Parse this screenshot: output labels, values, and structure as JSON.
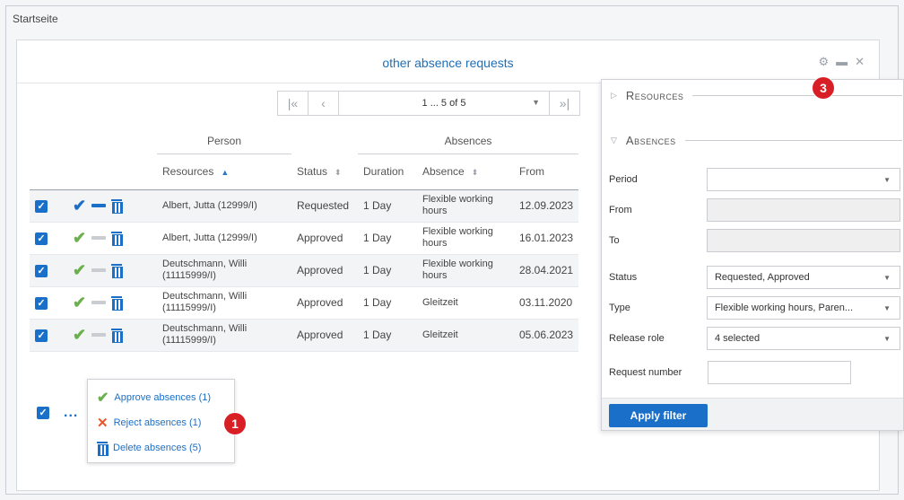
{
  "breadcrumb": "Startseite",
  "panel": {
    "title": "other absence requests"
  },
  "header_icons": [
    "gear-icon",
    "minimize-icon",
    "close-icon"
  ],
  "pager": {
    "info": "1 ... 5 of 5"
  },
  "table": {
    "group_headers": {
      "person": "Person",
      "absences": "Absences"
    },
    "columns": [
      "Resources",
      "Status",
      "Duration",
      "Absence",
      "From"
    ],
    "rows": [
      {
        "resource": "Albert, Jutta (12999/I)",
        "status": "Requested",
        "duration": "1 Day",
        "absence": "Flexible working hours",
        "from": "12.09.2023",
        "state": "requested"
      },
      {
        "resource": "Albert, Jutta (12999/I)",
        "status": "Approved",
        "duration": "1 Day",
        "absence": "Flexible working hours",
        "from": "16.01.2023",
        "state": "approved"
      },
      {
        "resource": "Deutschmann, Willi (11115999/I)",
        "status": "Approved",
        "duration": "1 Day",
        "absence": "Flexible working hours",
        "from": "28.04.2021",
        "state": "approved"
      },
      {
        "resource": "Deutschmann, Willi (11115999/I)",
        "status": "Approved",
        "duration": "1 Day",
        "absence": "Gleitzeit",
        "from": "03.11.2020",
        "state": "approved"
      },
      {
        "resource": "Deutschmann, Willi (11115999/I)",
        "status": "Approved",
        "duration": "1 Day",
        "absence": "Gleitzeit",
        "from": "05.06.2023",
        "state": "approved"
      }
    ]
  },
  "footer": {
    "more": "..."
  },
  "context_menu": {
    "approve": "Approve absences (1)",
    "reject": "Reject absences (1)",
    "delete": "Delete absences (5)"
  },
  "markers": {
    "m1": "1",
    "m3": "3"
  },
  "filter": {
    "sections": {
      "resources": "Resources",
      "absences": "Absences"
    },
    "labels": {
      "period": "Period",
      "from": "From",
      "to": "To",
      "status": "Status",
      "type": "Type",
      "release_role": "Release role",
      "request_number": "Request number"
    },
    "values": {
      "period": "",
      "from": "",
      "to": "",
      "status": "Requested, Approved",
      "type": "Flexible working hours, Paren...",
      "release_role": "4 selected",
      "request_number": ""
    },
    "apply_label": "Apply filter"
  },
  "colors": {
    "accent": "#1a6fc9",
    "approve": "#6ab04c",
    "reject": "#e8572a",
    "marker": "#d81f26"
  }
}
